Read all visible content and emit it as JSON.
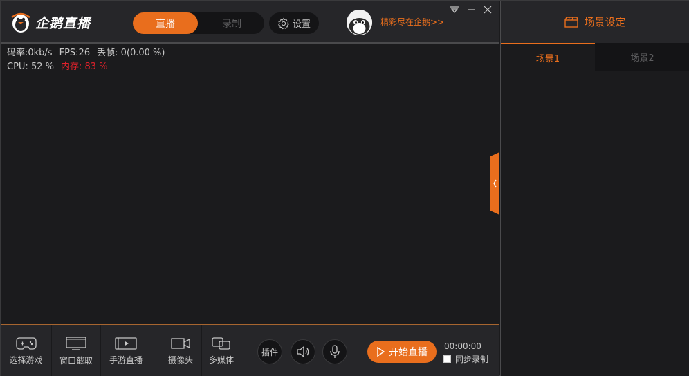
{
  "header": {
    "logo_text": "企鹅直播",
    "mode_tabs": {
      "live": "直播",
      "record": "录制"
    },
    "settings_label": "设置",
    "promo_link": "精彩尽在企鹅>>"
  },
  "stats": {
    "bitrate": "码率:0kb/s",
    "fps": "FPS:26",
    "dropped": "丢帧:  0(0.00 %)",
    "cpu": "CPU: 52 %",
    "memory": "内存: 83 %"
  },
  "right_panel": {
    "title": "场景设定",
    "scene_tabs": [
      "场景1",
      "场景2"
    ]
  },
  "toolbar": {
    "tools": [
      "选择游戏",
      "窗口截取",
      "手游直播",
      "摄像头",
      "多媒体"
    ],
    "plugins_label": "插件",
    "start_label": "开始直播",
    "timer": "00:00:00",
    "sync_record_label": "同步录制"
  },
  "colors": {
    "accent": "#e96e1d",
    "memory_warning": "#e0212b",
    "background": "#1b1b1d",
    "bar": "#262629"
  },
  "icons": {
    "logo": "penguin-logo-icon",
    "settings": "gear-icon",
    "window_controls": [
      "dropdown-icon",
      "minimize-icon",
      "close-icon"
    ],
    "scene_panel": "clapperboard-icon",
    "tools": [
      "gamepad-icon",
      "monitor-icon",
      "phone-play-icon",
      "camera-icon",
      "multimedia-icon"
    ],
    "speaker": "speaker-icon",
    "mic": "mic-icon",
    "start": "play-icon",
    "collapse": "chevron-left-icon"
  }
}
